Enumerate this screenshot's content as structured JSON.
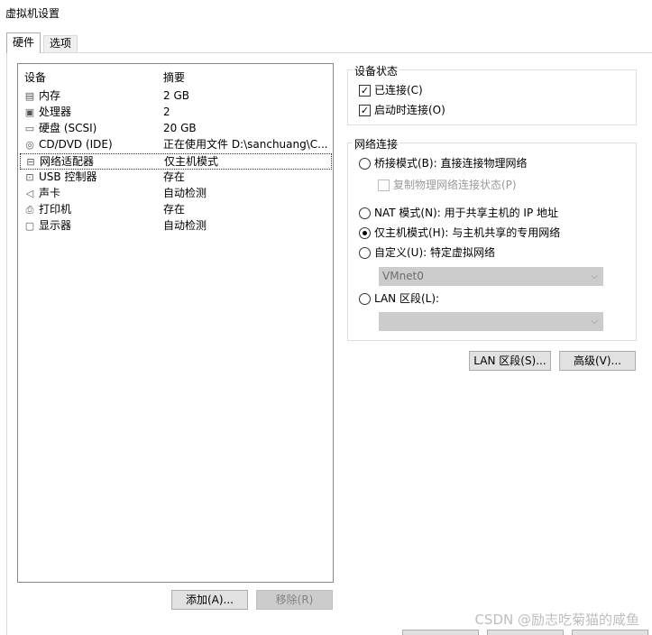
{
  "window": {
    "title": "虚拟机设置"
  },
  "tabs": [
    {
      "label": "硬件"
    },
    {
      "label": "选项"
    }
  ],
  "device_list": {
    "headers": {
      "device": "设备",
      "summary": "摘要"
    },
    "rows": [
      {
        "icon": "memory-icon",
        "name": "内存",
        "summary": "2 GB"
      },
      {
        "icon": "cpu-icon",
        "name": "处理器",
        "summary": "2"
      },
      {
        "icon": "harddisk-icon",
        "name": "硬盘 (SCSI)",
        "summary": "20 GB"
      },
      {
        "icon": "cd-icon",
        "name": "CD/DVD (IDE)",
        "summary": "正在使用文件 D:\\sanchuang\\C..."
      },
      {
        "icon": "network-adapter-icon",
        "name": "网络适配器",
        "summary": "仅主机模式"
      },
      {
        "icon": "usb-icon",
        "name": "USB 控制器",
        "summary": "存在"
      },
      {
        "icon": "speaker-icon",
        "name": "声卡",
        "summary": "自动检测"
      },
      {
        "icon": "printer-icon",
        "name": "打印机",
        "summary": "存在"
      },
      {
        "icon": "monitor-icon",
        "name": "显示器",
        "summary": "自动检测"
      }
    ],
    "selected_row": "网络适配器",
    "add_label": "添加(A)...",
    "remove_label": "移除(R)"
  },
  "device_status": {
    "title": "设备状态",
    "connected": {
      "label": "已连接(C)",
      "checked": true
    },
    "connect_at_power_on": {
      "label": "启动时连接(O)",
      "checked": true
    }
  },
  "network_connection": {
    "title": "网络连接",
    "bridged": {
      "label": "桥接模式(B): 直接连接物理网络",
      "selected": false
    },
    "replicate": {
      "label": "复制物理网络连接状态(P)",
      "checked": false
    },
    "nat": {
      "label": "NAT 模式(N): 用于共享主机的 IP 地址",
      "selected": false
    },
    "host_only": {
      "label": "仅主机模式(H): 与主机共享的专用网络",
      "selected": true
    },
    "custom": {
      "label": "自定义(U): 特定虚拟网络",
      "selected": false
    },
    "custom_value": "VMnet0",
    "lan_segment": {
      "label": "LAN 区段(L):",
      "selected": false
    },
    "lan_segment_value": ""
  },
  "buttons": {
    "lan_segments": "LAN 区段(S)...",
    "advanced": "高级(V)..."
  },
  "watermark": "CSDN @励志吃菊猫的咸鱼"
}
